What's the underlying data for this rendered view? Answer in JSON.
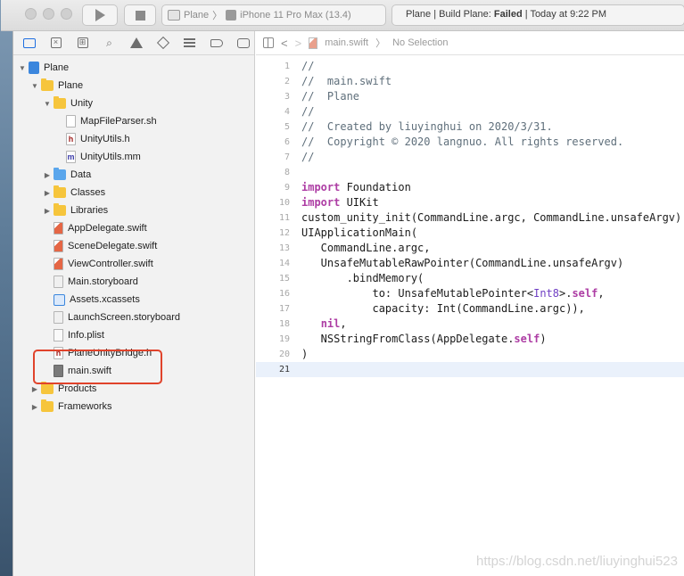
{
  "toolbar": {
    "scheme": "Plane",
    "separator": "〉",
    "destination": "iPhone 11 Pro Max (13.4)",
    "status_prefix": "Plane | Build Plane: ",
    "status_result": "Failed",
    "status_time": " | Today at 9:22 PM"
  },
  "navigator": {
    "tabs": [
      "folder-icon",
      "source-control-icon",
      "symbol-icon",
      "search-icon",
      "issue-icon",
      "test-icon",
      "debug-icon",
      "breakpoint-icon",
      "report-icon"
    ],
    "tree": [
      {
        "label": "Plane",
        "depth": 0,
        "disclosure": "open",
        "icon": "project"
      },
      {
        "label": "Plane",
        "depth": 1,
        "disclosure": "open",
        "icon": "folder"
      },
      {
        "label": "Unity",
        "depth": 2,
        "disclosure": "open",
        "icon": "folder"
      },
      {
        "label": "MapFileParser.sh",
        "depth": 3,
        "disclosure": "none",
        "icon": "sh"
      },
      {
        "label": "UnityUtils.h",
        "depth": 3,
        "disclosure": "none",
        "icon": "h"
      },
      {
        "label": "UnityUtils.mm",
        "depth": 3,
        "disclosure": "none",
        "icon": "m"
      },
      {
        "label": "Data",
        "depth": 2,
        "disclosure": "closed",
        "icon": "bfolder"
      },
      {
        "label": "Classes",
        "depth": 2,
        "disclosure": "closed",
        "icon": "folder"
      },
      {
        "label": "Libraries",
        "depth": 2,
        "disclosure": "closed",
        "icon": "folder"
      },
      {
        "label": "AppDelegate.swift",
        "depth": 2,
        "disclosure": "none",
        "icon": "swift"
      },
      {
        "label": "SceneDelegate.swift",
        "depth": 2,
        "disclosure": "none",
        "icon": "swift"
      },
      {
        "label": "ViewController.swift",
        "depth": 2,
        "disclosure": "none",
        "icon": "swift"
      },
      {
        "label": "Main.storyboard",
        "depth": 2,
        "disclosure": "none",
        "icon": "sb"
      },
      {
        "label": "Assets.xcassets",
        "depth": 2,
        "disclosure": "none",
        "icon": "assets"
      },
      {
        "label": "LaunchScreen.storyboard",
        "depth": 2,
        "disclosure": "none",
        "icon": "sb"
      },
      {
        "label": "Info.plist",
        "depth": 2,
        "disclosure": "none",
        "icon": "plist"
      },
      {
        "label": "PlaneUnityBridge.h",
        "depth": 2,
        "disclosure": "none",
        "icon": "h"
      },
      {
        "label": "main.swift",
        "depth": 2,
        "disclosure": "none",
        "icon": "swift-dim"
      },
      {
        "label": "Products",
        "depth": 1,
        "disclosure": "closed",
        "icon": "folder"
      },
      {
        "label": "Frameworks",
        "depth": 1,
        "disclosure": "closed",
        "icon": "folder"
      }
    ]
  },
  "editor": {
    "file_name": "main.swift",
    "separator": "〉",
    "selection": "No Selection",
    "active_line": 21,
    "lines": [
      [
        [
          "cm",
          "//"
        ]
      ],
      [
        [
          "cm",
          "//  main.swift"
        ]
      ],
      [
        [
          "cm",
          "//  Plane"
        ]
      ],
      [
        [
          "cm",
          "//"
        ]
      ],
      [
        [
          "cm",
          "//  Created by liuyinghui on 2020/3/31."
        ]
      ],
      [
        [
          "cm",
          "//  Copyright © 2020 langnuo. All rights reserved."
        ]
      ],
      [
        [
          "cm",
          "//"
        ]
      ],
      [],
      [
        [
          "kw",
          "import"
        ],
        [
          "tx",
          " Foundation"
        ]
      ],
      [
        [
          "kw",
          "import"
        ],
        [
          "tx",
          " UIKit"
        ]
      ],
      [
        [
          "tx",
          "custom_unity_init(CommandLine.argc, CommandLine.unsafeArgv)"
        ]
      ],
      [
        [
          "tx",
          "UIApplicationMain("
        ]
      ],
      [
        [
          "tx",
          "   CommandLine.argc,"
        ]
      ],
      [
        [
          "tx",
          "   UnsafeMutableRawPointer(CommandLine.unsafeArgv)"
        ]
      ],
      [
        [
          "tx",
          "       .bindMemory("
        ]
      ],
      [
        [
          "tx",
          "           to: UnsafeMutablePointer<"
        ],
        [
          "ty",
          "Int8"
        ],
        [
          "tx",
          ">."
        ],
        [
          "kw",
          "self"
        ],
        [
          "tx",
          ","
        ]
      ],
      [
        [
          "tx",
          "           capacity: Int(CommandLine.argc)),"
        ]
      ],
      [
        [
          "tx",
          "   "
        ],
        [
          "kw",
          "nil"
        ],
        [
          "tx",
          ","
        ]
      ],
      [
        [
          "tx",
          "   NSStringFromClass(AppDelegate."
        ],
        [
          "kw",
          "self"
        ],
        [
          "tx",
          ")"
        ]
      ],
      [
        [
          "tx",
          ")"
        ]
      ],
      []
    ]
  },
  "watermark": "https://blog.csdn.net/liuyinghui523"
}
